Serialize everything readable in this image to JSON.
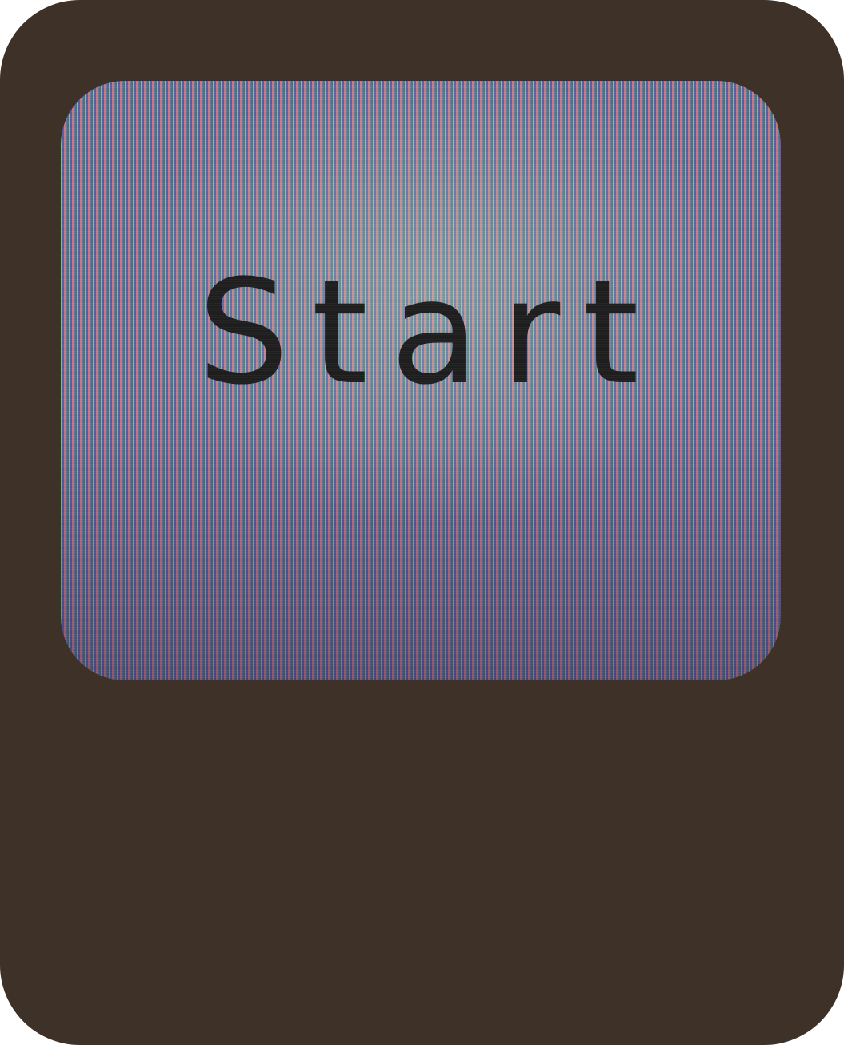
{
  "start_button": {
    "label": "Start"
  },
  "colors": {
    "device_background": "#3e3127",
    "label_color": "#1f1f1f"
  }
}
